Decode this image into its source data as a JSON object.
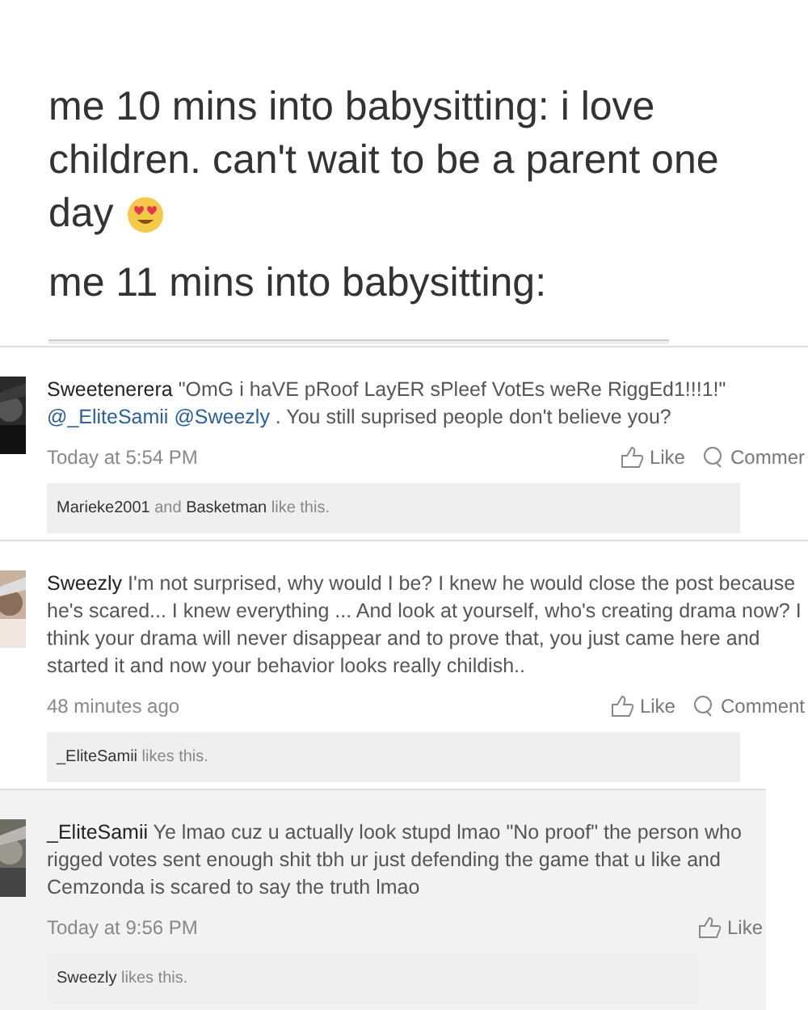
{
  "caption": {
    "lines": [
      {
        "kind": "line",
        "text": "me 10 mins into babysitting: i love"
      },
      {
        "kind": "line",
        "text": "children. can't wait to be a parent one"
      },
      {
        "kind": "emoji-line",
        "text": "day"
      },
      {
        "kind": "line",
        "text": "me 11 mins into babysitting:"
      }
    ]
  },
  "comments": [
    {
      "author": "Sweetenerera",
      "shaded": false,
      "body": [
        {
          "kind": "text",
          "text": "\"OmG i haVE pRoof LayER sPleef VotEs weRe RiggEd1!!!1!\" "
        },
        {
          "kind": "mention",
          "text": "@_EliteSamii"
        },
        {
          "kind": "mention",
          "text": "@Sweezly"
        },
        {
          "kind": "text",
          "text": " . You still suprised people don't believe you?"
        }
      ],
      "time": "Today at 5:54 PM",
      "actions": [
        {
          "kind": "like",
          "label": "Like"
        },
        {
          "kind": "comment",
          "label": "Commer"
        }
      ],
      "likes": [
        {
          "kind": "name",
          "text": "Marieke2001"
        },
        {
          "kind": "text",
          "text": " and "
        },
        {
          "kind": "name",
          "text": "Basketman"
        },
        {
          "kind": "text",
          "text": " like this."
        }
      ]
    },
    {
      "author": "Sweezly",
      "shaded": false,
      "body": [
        {
          "kind": "text",
          "text": "I'm not surprised, why would I be? I knew he would close the post because he's scared... I knew everything ... And look at yourself, who's creating drama now? I think your drama will never disappear and to prove that, you just came here and started it and now your behavior looks really childish.."
        }
      ],
      "time": "48 minutes ago",
      "actions": [
        {
          "kind": "like",
          "label": "Like"
        },
        {
          "kind": "comment",
          "label": "Comment"
        }
      ],
      "likes": [
        {
          "kind": "name",
          "text": "_EliteSamii"
        },
        {
          "kind": "text",
          "text": " likes this."
        }
      ]
    },
    {
      "author": "_EliteSamii",
      "shaded": true,
      "body": [
        {
          "kind": "text",
          "text": "Ye lmao cuz u actually look stupd lmao \"No proof\" the person who rigged votes sent enough shit tbh ur just defending the game that u like and Cemzonda is scared to say the truth lmao"
        }
      ],
      "time": "Today at 9:56 PM",
      "actions": [
        {
          "kind": "like",
          "label": "Like"
        }
      ],
      "likes": [
        {
          "kind": "name",
          "text": "Sweezly"
        },
        {
          "kind": "text",
          "text": " likes this."
        }
      ]
    }
  ]
}
